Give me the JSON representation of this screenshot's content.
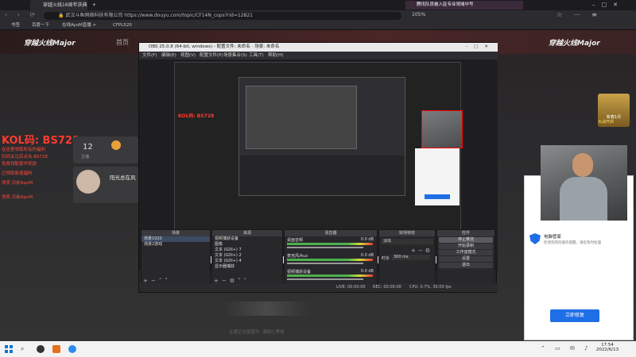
{
  "browser": {
    "tabs": [
      {
        "label": "穿越火线16周年庆典"
      },
      {
        "label": "+"
      }
    ],
    "address": "🔒 武汉斗鱼网络科技有限公司 https://www.douyu.com/topic/CF14N_cops?rid=12821",
    "zoom": "105%",
    "notice": "腾讯队员被入驻专业领域中号",
    "bookmarks": [
      "书签",
      "百度一下",
      "在线AyoM直播 >",
      "CFPL520"
    ]
  },
  "site": {
    "logo_left": "穿越火线Major",
    "nav": [
      "首页"
    ],
    "logo_right": "穿越火线Major",
    "kol": "KOL码: BS728",
    "red_lines": [
      "在这里领取所有的福利",
      "扫码关注后点击·BS728",
      "免费领取豪华奖励",
      "已领取新增福利",
      "领奖·日前ApoM",
      "领奖·日前ApoM"
    ],
    "stat_number": "12",
    "stat_label": "主播",
    "anchor_name": "阳光总在风",
    "right_badge": "新春1月",
    "right_badge2": "大战开启"
  },
  "obs": {
    "title": "OBS 25.0.8 (64-bit, windows) - 配置文件: 未命名 - 场景: 未命名",
    "menu": [
      "文件(F)",
      "编辑(E)",
      "视图(V)",
      "配置文件(P)",
      "场景集合(S)",
      "工具(T)",
      "帮助(H)"
    ],
    "docks": {
      "scenes": {
        "title": "场景",
        "items": [
          "场景1920",
          "场景2游戏"
        ]
      },
      "sources": {
        "title": "来源",
        "items": [
          "视频捕获设备",
          "图像",
          "文本 (GDI+) 7",
          "文本 (GDI+) 2",
          "文本 (GDI+) 4",
          "显示器捕获"
        ]
      },
      "mixer": {
        "title": "混音器",
        "channels": [
          {
            "name": "桌面音频",
            "db": "0.0 dB"
          },
          {
            "name": "麦克风/Aux",
            "db": "0.0 dB"
          },
          {
            "name": "视频捕获设备",
            "db": "0.0 dB"
          }
        ]
      },
      "transitions": {
        "title": "转场特效",
        "fade": "淡出",
        "duration_label": "时长",
        "duration": "300 ms"
      },
      "controls": {
        "title": "控件",
        "buttons": [
          "停止推流",
          "开始录制",
          "工作室模式",
          "设置",
          "退出"
        ]
      }
    },
    "status": {
      "live": "LIVE: 00:00:00",
      "rec": "REC: 00:00:00",
      "cpu": "CPU: 0.7%, 30.00 fps"
    }
  },
  "popup": {
    "title": "电脑管家",
    "text": "检测到风险操作提醒，请您及时处理",
    "button": "立即修复"
  },
  "taskbar": {
    "time": "17:54",
    "date": "2022/6/13"
  },
  "page_caption": "主播正在搞直中, 请耐心等候"
}
